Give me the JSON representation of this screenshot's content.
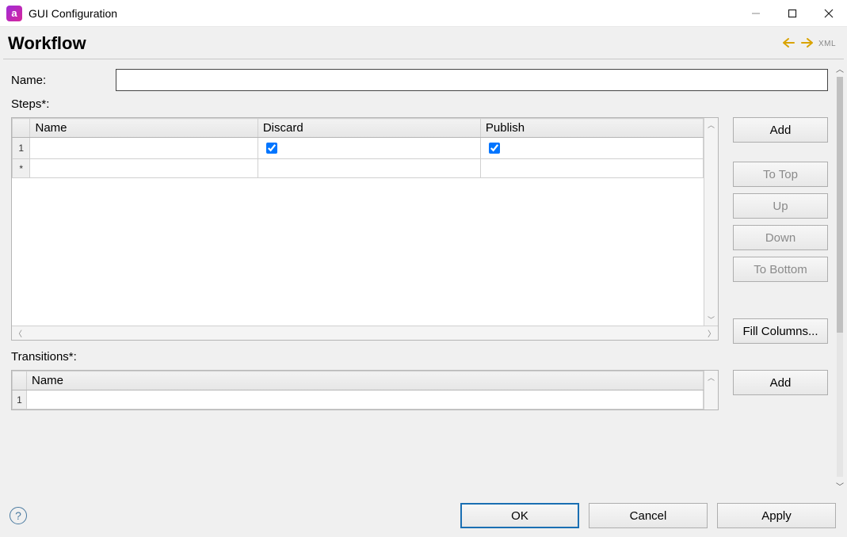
{
  "window": {
    "title": "GUI Configuration"
  },
  "header": {
    "title": "Workflow",
    "xml": "XML"
  },
  "form": {
    "name_label": "Name:",
    "name_value": "",
    "steps_label": "Steps*:",
    "transitions_label": "Transitions*:"
  },
  "steps_grid": {
    "columns": {
      "name": "Name",
      "discard": "Discard",
      "publish": "Publish"
    },
    "rows": [
      {
        "rownum": "1",
        "name": "",
        "discard": true,
        "publish": true
      },
      {
        "rownum": "*",
        "name": "",
        "discard": null,
        "publish": null
      }
    ]
  },
  "transitions_grid": {
    "columns": {
      "name": "Name"
    },
    "rows": [
      {
        "rownum": "1",
        "name": ""
      }
    ]
  },
  "buttons": {
    "add": "Add",
    "to_top": "To Top",
    "up": "Up",
    "down": "Down",
    "to_bottom": "To Bottom",
    "fill_columns": "Fill Columns...",
    "ok": "OK",
    "cancel": "Cancel",
    "apply": "Apply"
  }
}
